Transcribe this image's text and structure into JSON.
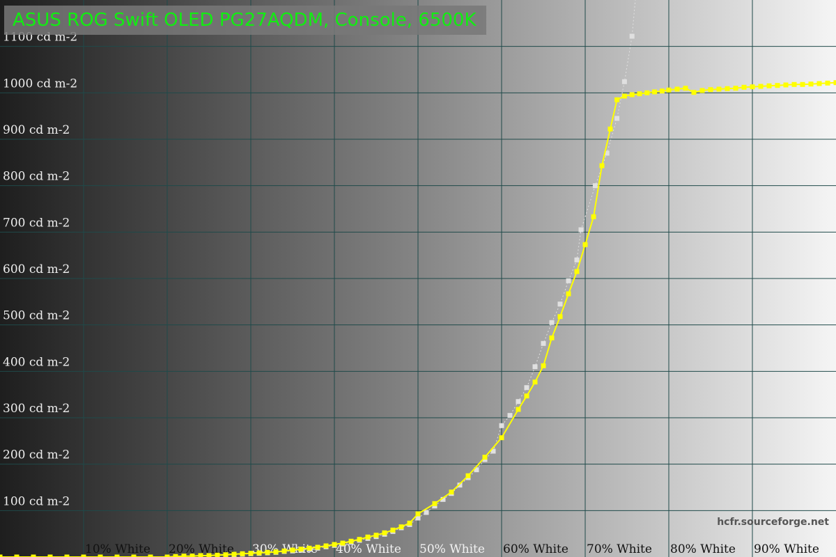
{
  "title": "ASUS ROG Swift OLED PG27AQDM, Console, 6500K",
  "watermark": "hcfr.sourceforge.net",
  "chart_data": {
    "type": "line",
    "title": "ASUS ROG Swift OLED PG27AQDM, Console, 6500K",
    "x_tick_labels": [
      "10% White",
      "20% White",
      "30% White",
      "40% White",
      "50% White",
      "60% White",
      "70% White",
      "80% White",
      "90% White"
    ],
    "y_tick_labels": [
      "100 cd m-2",
      "200 cd m-2",
      "300 cd m-2",
      "400 cd m-2",
      "500 cd m-2",
      "600 cd m-2",
      "700 cd m-2",
      "800 cd m-2",
      "900 cd m-2",
      "1000 cd m-2",
      "1100 cd m-2"
    ],
    "xlim": [
      0,
      100
    ],
    "ylim": [
      0,
      1200
    ],
    "grid": true,
    "legend": "none",
    "series": [
      {
        "color": "#ffff00",
        "style": "solid",
        "points": [
          [
            0,
            0
          ],
          [
            2,
            0
          ],
          [
            4,
            0
          ],
          [
            6,
            0
          ],
          [
            8,
            0
          ],
          [
            10,
            0
          ],
          [
            12,
            0
          ],
          [
            14,
            0
          ],
          [
            16,
            0
          ],
          [
            18,
            0
          ],
          [
            20,
            0
          ],
          [
            21,
            1
          ],
          [
            22,
            2
          ],
          [
            23,
            2
          ],
          [
            24,
            3
          ],
          [
            25,
            3
          ],
          [
            26,
            4
          ],
          [
            27,
            5
          ],
          [
            28,
            6
          ],
          [
            29,
            7
          ],
          [
            30,
            8
          ],
          [
            31,
            9
          ],
          [
            32,
            10
          ],
          [
            33,
            11
          ],
          [
            34,
            13
          ],
          [
            35,
            15
          ],
          [
            36,
            17
          ],
          [
            37,
            19
          ],
          [
            38,
            21
          ],
          [
            39,
            24
          ],
          [
            40,
            27
          ],
          [
            41,
            30
          ],
          [
            42,
            34
          ],
          [
            43,
            38
          ],
          [
            44,
            43
          ],
          [
            45,
            47
          ],
          [
            46,
            52
          ],
          [
            47,
            58
          ],
          [
            48,
            65
          ],
          [
            49,
            73
          ],
          [
            50,
            93
          ],
          [
            52,
            115
          ],
          [
            54,
            140
          ],
          [
            56,
            175
          ],
          [
            58,
            215
          ],
          [
            60,
            257
          ],
          [
            62,
            318
          ],
          [
            63,
            347
          ],
          [
            64,
            377
          ],
          [
            65,
            412
          ],
          [
            66,
            472
          ],
          [
            67,
            518
          ],
          [
            68,
            567
          ],
          [
            69,
            615
          ],
          [
            70,
            673
          ],
          [
            71,
            733
          ],
          [
            72,
            843
          ],
          [
            73,
            922
          ],
          [
            73.8,
            985
          ],
          [
            74.7,
            993
          ],
          [
            75.6,
            996
          ],
          [
            76.5,
            998
          ],
          [
            77.4,
            1000
          ],
          [
            78.3,
            1002
          ],
          [
            79.2,
            1004
          ],
          [
            80,
            1006
          ],
          [
            81,
            1008
          ],
          [
            82,
            1010
          ],
          [
            83,
            1001
          ],
          [
            84,
            1005
          ],
          [
            85,
            1007
          ],
          [
            86,
            1008
          ],
          [
            87,
            1009
          ],
          [
            88,
            1010
          ],
          [
            89,
            1012
          ],
          [
            90,
            1013
          ],
          [
            91,
            1014
          ],
          [
            92,
            1015
          ],
          [
            93,
            1016
          ],
          [
            94,
            1017
          ],
          [
            95,
            1018
          ],
          [
            96,
            1018
          ],
          [
            97,
            1019
          ],
          [
            98,
            1020
          ],
          [
            99,
            1021
          ],
          [
            100,
            1022
          ]
        ]
      },
      {
        "color": "#e0e0e0",
        "style": "dotted",
        "points": [
          [
            24,
            2
          ],
          [
            25,
            3
          ],
          [
            26,
            3
          ],
          [
            27,
            4
          ],
          [
            28,
            5
          ],
          [
            29,
            6
          ],
          [
            30,
            7
          ],
          [
            31,
            8
          ],
          [
            32,
            9
          ],
          [
            33,
            10
          ],
          [
            34,
            12
          ],
          [
            35,
            13
          ],
          [
            36,
            15
          ],
          [
            37,
            17
          ],
          [
            38,
            19
          ],
          [
            39,
            22
          ],
          [
            40,
            25
          ],
          [
            41,
            28
          ],
          [
            42,
            32
          ],
          [
            43,
            36
          ],
          [
            44,
            40
          ],
          [
            45,
            44
          ],
          [
            46,
            49
          ],
          [
            47,
            55
          ],
          [
            48,
            63
          ],
          [
            49,
            70
          ],
          [
            50,
            84
          ],
          [
            51,
            96
          ],
          [
            52,
            110
          ],
          [
            53,
            124
          ],
          [
            54,
            137
          ],
          [
            55,
            155
          ],
          [
            56,
            171
          ],
          [
            57,
            188
          ],
          [
            58,
            210
          ],
          [
            59,
            228
          ],
          [
            60,
            283
          ],
          [
            61,
            305
          ],
          [
            62,
            335
          ],
          [
            63,
            365
          ],
          [
            64,
            410
          ],
          [
            65,
            460
          ],
          [
            66,
            505
          ],
          [
            67,
            545
          ],
          [
            68,
            595
          ],
          [
            69,
            640
          ],
          [
            69.5,
            705
          ],
          [
            71.2,
            800
          ],
          [
            72.6,
            870
          ],
          [
            73.8,
            945
          ],
          [
            74.7,
            1024
          ],
          [
            75.6,
            1122
          ],
          [
            76.2,
            1240
          ]
        ]
      }
    ]
  }
}
